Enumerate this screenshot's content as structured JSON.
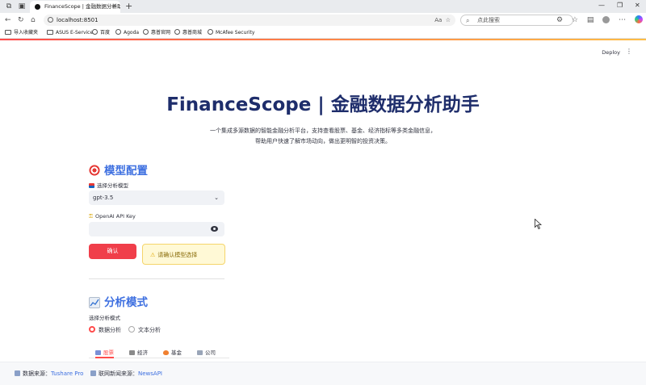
{
  "browser": {
    "tab_title": "FinanceScope | 金融数据分析助手",
    "url": "localhost:8501",
    "search_placeholder": "点此搜索",
    "bookmarks": [
      "导入收藏夹",
      "ASUS E-Service",
      "百度",
      "Agoda",
      "惠普官网",
      "惠普商城",
      "McAfee Security"
    ]
  },
  "header": {
    "deploy_label": "Deploy"
  },
  "main": {
    "title": "FinanceScope | 金融数据分析助手",
    "subtitle_line1": "一个集成多源数据的智能金融分析平台，支持查看股票、基金、经济指标等多类金融信息，",
    "subtitle_line2": "帮助用户快速了解市场动向，做出更明智的投资决策。"
  },
  "model_config": {
    "heading": "模型配置",
    "select_label": "选择分析模型",
    "selected_model": "gpt-3.5",
    "api_key_label": "OpenAI API Key",
    "confirm_label": "确认",
    "warning_text": "请确认模型选择"
  },
  "analysis_mode": {
    "heading": "分析模式",
    "radio_label": "选择分析模式",
    "options": [
      "数据分析",
      "文本分析"
    ],
    "selected": "数据分析"
  },
  "tabs": [
    "股票",
    "经济",
    "基金",
    "公司"
  ],
  "footer": {
    "source_label": "数据来源：",
    "source_value": "Tushare Pro",
    "news_label": "联网新闻来源：",
    "news_value": "NewsAPI"
  },
  "colors": {
    "primary": "#ff4b4b",
    "title": "#1e2d6b",
    "heading": "#3d6fe0",
    "warning_bg": "#fff9d6"
  }
}
